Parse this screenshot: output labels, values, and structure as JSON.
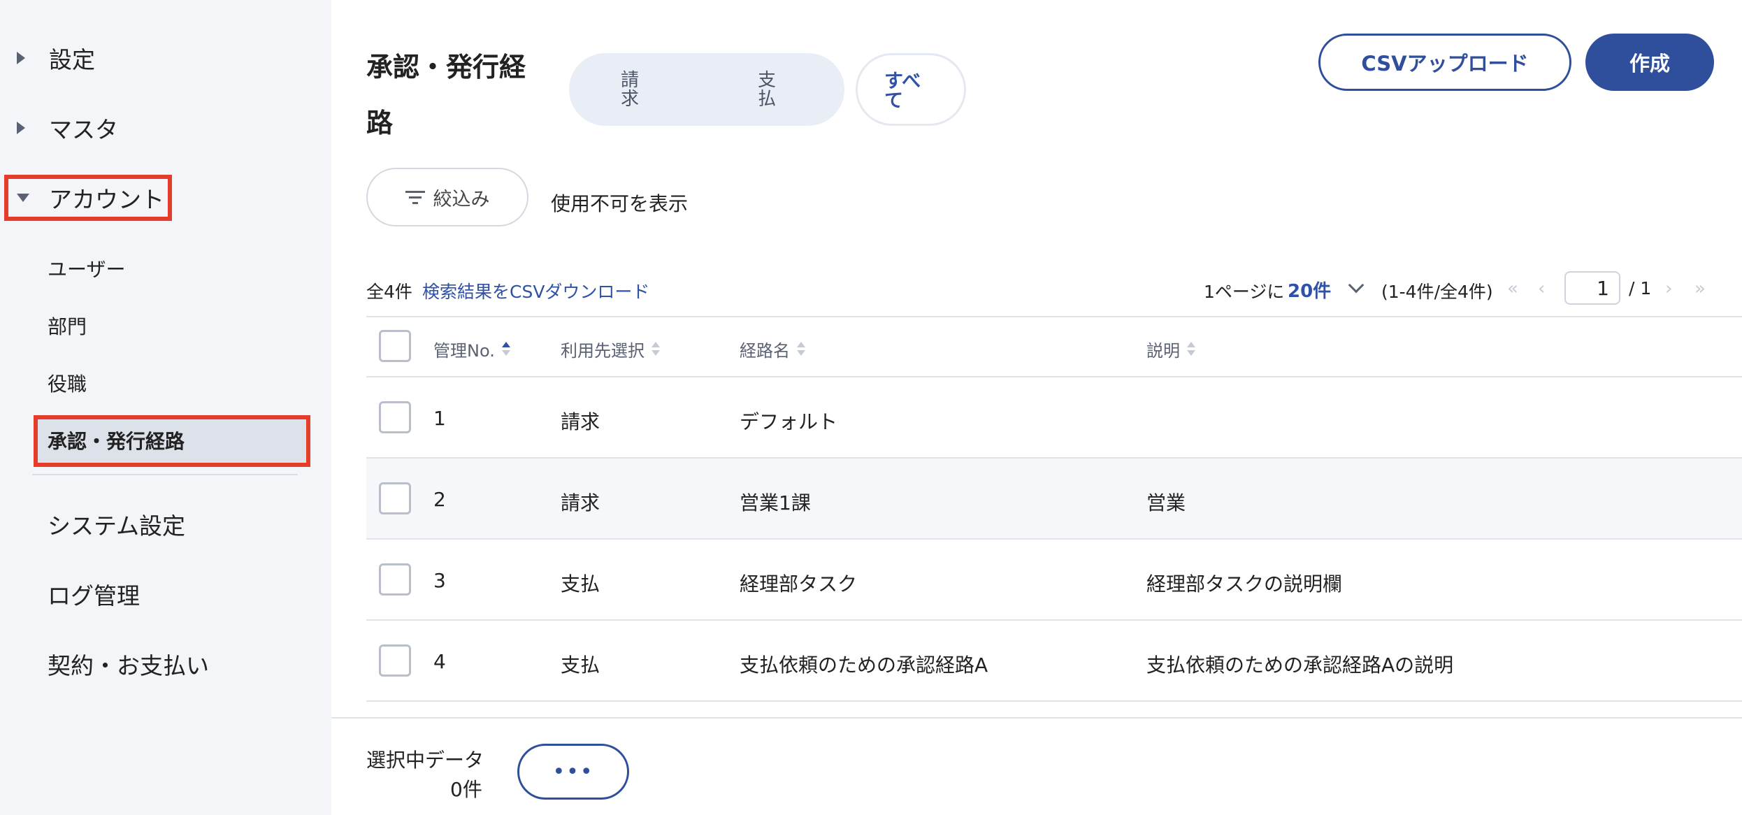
{
  "sidebar": {
    "groups": [
      {
        "label": "設定"
      },
      {
        "label": "マスタ"
      },
      {
        "label": "アカウント"
      }
    ],
    "account_items": [
      {
        "label": "ユーザー"
      },
      {
        "label": "部門"
      },
      {
        "label": "役職"
      },
      {
        "label": "承認・発行経路"
      }
    ],
    "bottom_items": [
      {
        "label": "システム設定"
      },
      {
        "label": "ログ管理"
      },
      {
        "label": "契約・お支払い"
      }
    ]
  },
  "header": {
    "title": "承認・発行経路",
    "segments": [
      "請求",
      "支払",
      "すべて"
    ],
    "csv_upload": "CSVアップロード",
    "create": "作成"
  },
  "filter": {
    "button": "絞込み",
    "show_disabled": "使用不可を表示"
  },
  "toolbar": {
    "total": "全4件",
    "csv_download": "検索結果をCSVダウンロード",
    "per_page_label": "1ページに",
    "per_page_value": "20件",
    "range": "(1-4件/全4件)",
    "first": "«",
    "prev": "‹",
    "next": "›",
    "last": "»",
    "current_page": "1",
    "total_pages": "/ 1"
  },
  "table": {
    "columns": [
      "管理No.",
      "利用先選択",
      "経路名",
      "説明"
    ],
    "rows": [
      {
        "no": "1",
        "usage": "請求",
        "name": "デフォルト",
        "desc": ""
      },
      {
        "no": "2",
        "usage": "請求",
        "name": "営業1課",
        "desc": "営業"
      },
      {
        "no": "3",
        "usage": "支払",
        "name": "経理部タスク",
        "desc": "経理部タスクの説明欄"
      },
      {
        "no": "4",
        "usage": "支払",
        "name": "支払依頼のための承認経路A",
        "desc": "支払依頼のための承認経路Aの説明"
      }
    ]
  },
  "bottom": {
    "selected_label": "選択中データ",
    "selected_count": "0件",
    "more": "•••"
  },
  "colors": {
    "accent": "#2f4f9c",
    "highlight": "#e53d29",
    "sidebar_bg": "#f3f5f9"
  }
}
